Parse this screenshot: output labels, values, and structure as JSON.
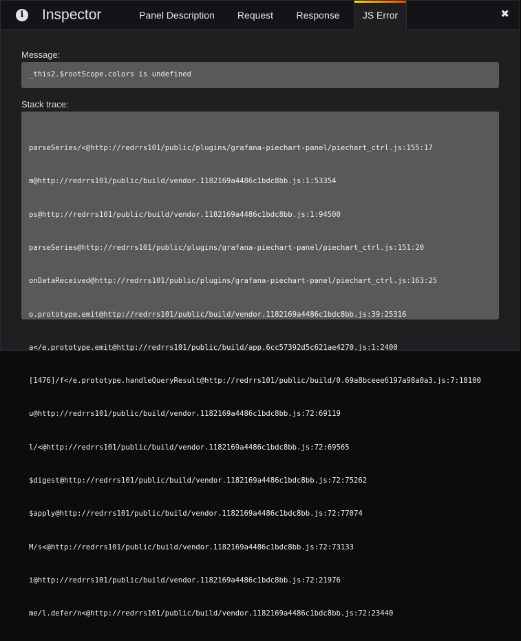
{
  "header": {
    "title": "Inspector",
    "info_icon": "info-icon",
    "tabs": [
      {
        "label": "Panel Description",
        "active": false
      },
      {
        "label": "Request",
        "active": false
      },
      {
        "label": "Response",
        "active": false
      },
      {
        "label": "JS Error",
        "active": true
      }
    ],
    "close_label": "✖"
  },
  "colors": {
    "active_tab_gradient": [
      "#ffd500",
      "#ff4400"
    ],
    "code_box_bg": "#58595b"
  },
  "message": {
    "label": "Message:",
    "text": "_this2.$rootScope.colors is undefined"
  },
  "stack": {
    "label": "Stack trace:",
    "lines": [
      "parseSeries/<@http://redrrs101/public/plugins/grafana-piechart-panel/piechart_ctrl.js:155:17",
      "m@http://redrrs101/public/build/vendor.1182169a4486c1bdc8bb.js:1:53354",
      "ps@http://redrrs101/public/build/vendor.1182169a4486c1bdc8bb.js:1:94500",
      "parseSeries@http://redrrs101/public/plugins/grafana-piechart-panel/piechart_ctrl.js:151:20",
      "onDataReceived@http://redrrs101/public/plugins/grafana-piechart-panel/piechart_ctrl.js:163:25",
      "o.prototype.emit@http://redrrs101/public/build/vendor.1182169a4486c1bdc8bb.js:39:25316",
      "a</e.prototype.emit@http://redrrs101/public/build/app.6cc57392d5c621ae4270.js:1:2400",
      "[1476]/f</e.prototype.handleQueryResult@http://redrrs101/public/build/0.69a8bceee6197a98a0a3.js:7:18100",
      "u@http://redrrs101/public/build/vendor.1182169a4486c1bdc8bb.js:72:69119",
      "l/<@http://redrrs101/public/build/vendor.1182169a4486c1bdc8bb.js:72:69565",
      "$digest@http://redrrs101/public/build/vendor.1182169a4486c1bdc8bb.js:72:75262",
      "$apply@http://redrrs101/public/build/vendor.1182169a4486c1bdc8bb.js:72:77074",
      "M/s<@http://redrrs101/public/build/vendor.1182169a4486c1bdc8bb.js:72:73133",
      "i@http://redrrs101/public/build/vendor.1182169a4486c1bdc8bb.js:72:21976",
      "me/l.defer/n<@http://redrrs101/public/build/vendor.1182169a4486c1bdc8bb.js:72:23440"
    ]
  }
}
